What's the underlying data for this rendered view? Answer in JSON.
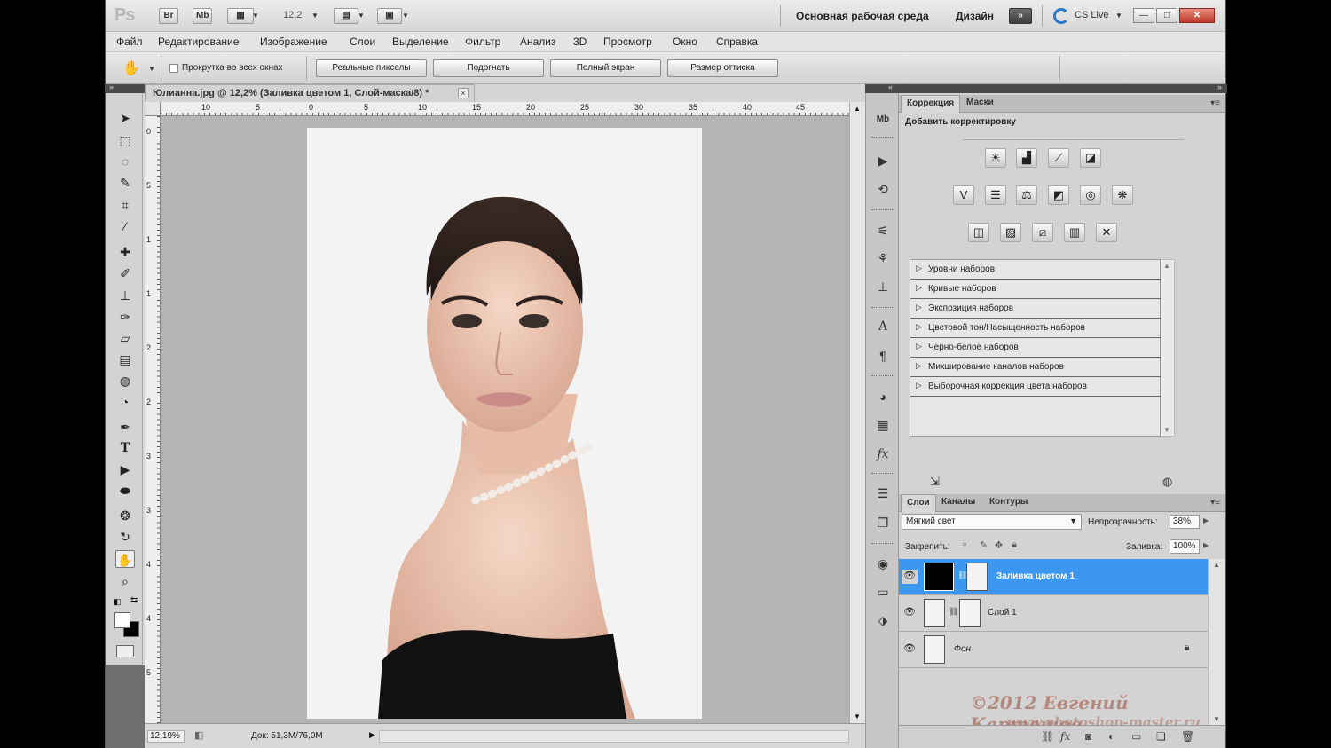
{
  "appbar": {
    "logo": "Ps",
    "br_label": "Br",
    "mb_label": "Mb",
    "zoom": "12,2",
    "workspace": "Основная рабочая среда",
    "design": "Дизайн",
    "cslive": "CS Live"
  },
  "menu": [
    "Файл",
    "Редактирование",
    "Изображение",
    "Слои",
    "Выделение",
    "Фильтр",
    "Анализ",
    "3D",
    "Просмотр",
    "Окно",
    "Справка"
  ],
  "options": {
    "scroll_all": "Прокрутка во всех окнах",
    "actual_pixels": "Реальные пикселы",
    "fit": "Подогнать",
    "full_screen": "Полный экран",
    "print_size": "Размер оттиска"
  },
  "document": {
    "tab_title": "Юлианна.jpg @ 12,2% (Заливка цветом 1, Слой-маска/8) *",
    "close": "×",
    "ruler_top": [
      "10",
      "5",
      "0",
      "5",
      "10",
      "15",
      "20",
      "25",
      "30",
      "35",
      "40",
      "45"
    ],
    "ruler_left": [
      "0",
      "5",
      "1",
      "1",
      "2",
      "2",
      "3",
      "3",
      "4",
      "4",
      "5"
    ],
    "status_zoom": "12,19%",
    "status_doc": "Док: 51,3M/76,0M"
  },
  "adjustments": {
    "tab_correction": "Коррекция",
    "tab_masks": "Маски",
    "heading": "Добавить корректировку",
    "presets": [
      "Уровни наборов",
      "Кривые наборов",
      "Экспозиция наборов",
      "Цветовой тон/Насыщенность наборов",
      "Черно-белое наборов",
      "Микширование каналов наборов",
      "Выборочная коррекция цвета наборов"
    ]
  },
  "layers": {
    "tab_layers": "Слои",
    "tab_channels": "Каналы",
    "tab_paths": "Контуры",
    "blend_mode": "Мягкий свет",
    "opacity_label": "Непрозрачность:",
    "opacity": "38%",
    "lock_label": "Закрепить:",
    "fill_label": "Заливка:",
    "fill": "100%",
    "items": [
      {
        "name": "Заливка цветом 1",
        "selected": true
      },
      {
        "name": "Слой 1",
        "selected": false
      },
      {
        "name": "Фон",
        "selected": false
      }
    ]
  },
  "watermark": {
    "line1": "©2012 Евгений Карташов",
    "line2": "www.photoshop-master.ru"
  },
  "colors": {
    "selection": "#3b97f0",
    "workspace_bg": "#b4b4b4",
    "canvas_bg": "#f3f3f3"
  }
}
